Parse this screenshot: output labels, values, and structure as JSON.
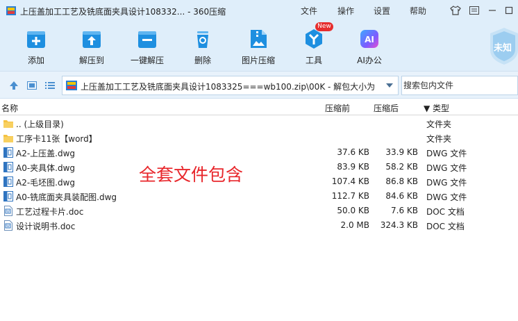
{
  "window": {
    "title": "上压盖加工工艺及铣底面夹具设计108332... - 360压缩",
    "menu": [
      "文件",
      "操作",
      "设置",
      "帮助"
    ]
  },
  "toolbar": {
    "items": [
      {
        "label": "添加",
        "icon": "add-icon"
      },
      {
        "label": "解压到",
        "icon": "extract-to-icon"
      },
      {
        "label": "一键解压",
        "icon": "one-click-extract-icon"
      },
      {
        "label": "删除",
        "icon": "delete-icon"
      },
      {
        "label": "图片压缩",
        "icon": "image-compress-icon"
      },
      {
        "label": "工具",
        "icon": "tools-icon"
      },
      {
        "label": "AI办公",
        "icon": "ai-office-icon"
      }
    ],
    "new_badge": "New",
    "shield_label": "未知",
    "ai_glyph": "AI"
  },
  "address": {
    "path": "上压盖加工工艺及铣底面夹具设计1083325===wb100.zip\\00K - 解包大小为",
    "search_placeholder": "搜索包内文件"
  },
  "list": {
    "columns": {
      "name": "名称",
      "packed": "压缩前",
      "unpacked": "压缩后",
      "type": "▼ 类型"
    },
    "rows": [
      {
        "name": ".. (上级目录)",
        "packed": "",
        "unpacked": "",
        "type": "文件夹",
        "kind": "folder"
      },
      {
        "name": "工序卡11张【word】",
        "packed": "",
        "unpacked": "",
        "type": "文件夹",
        "kind": "folder"
      },
      {
        "name": "A2-上压盖.dwg",
        "packed": "37.6 KB",
        "unpacked": "33.9 KB",
        "type": "DWG 文件",
        "kind": "dwg"
      },
      {
        "name": "A0-夹具体.dwg",
        "packed": "83.9 KB",
        "unpacked": "58.2 KB",
        "type": "DWG 文件",
        "kind": "dwg"
      },
      {
        "name": "A2-毛坯图.dwg",
        "packed": "107.4 KB",
        "unpacked": "86.8 KB",
        "type": "DWG 文件",
        "kind": "dwg"
      },
      {
        "name": "A0-铣底面夹具装配图.dwg",
        "packed": "112.7 KB",
        "unpacked": "84.6 KB",
        "type": "DWG 文件",
        "kind": "dwg"
      },
      {
        "name": "工艺过程卡片.doc",
        "packed": "50.0 KB",
        "unpacked": "7.6 KB",
        "type": "DOC 文档",
        "kind": "doc"
      },
      {
        "name": "设计说明书.doc",
        "packed": "2.0 MB",
        "unpacked": "324.3 KB",
        "type": "DOC 文档",
        "kind": "doc"
      }
    ]
  },
  "overlay": "全套文件包含",
  "colors": {
    "accent": "#1e8fe0",
    "title_bar": "#dfeefa",
    "folder": "#f5c242",
    "overlay_red": "#e8262b"
  }
}
